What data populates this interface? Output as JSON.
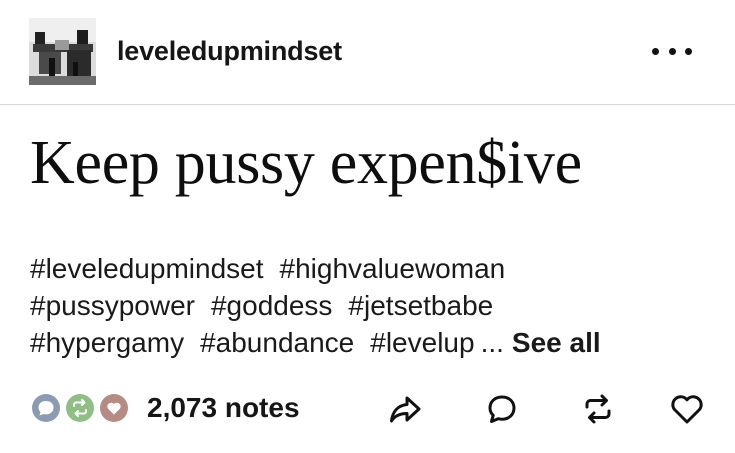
{
  "post": {
    "blog_name": "leveledupmindset",
    "title": "Keep pussy expen$ive",
    "tag_rows": [
      [
        "#leveledupmindset",
        "#highvaluewoman"
      ],
      [
        "#pussypower",
        "#goddess",
        "#jetsetbabe"
      ],
      [
        "#hypergamy",
        "#abundance",
        "#levelup"
      ]
    ],
    "tags_more": "...",
    "see_all_label": "See all",
    "notes_count": "2,073 notes"
  },
  "icons": {
    "more": "more-horizontal-icon",
    "share": "share-icon",
    "reply": "reply-icon",
    "reblog": "reblog-icon",
    "like": "heart-icon"
  },
  "colors": {
    "text": "#111111",
    "reply_bubble": "#8b9bb4",
    "reblog_bubble": "#8fbf84",
    "like_bubble": "#b58b84",
    "divider": "#d8d8d8"
  }
}
